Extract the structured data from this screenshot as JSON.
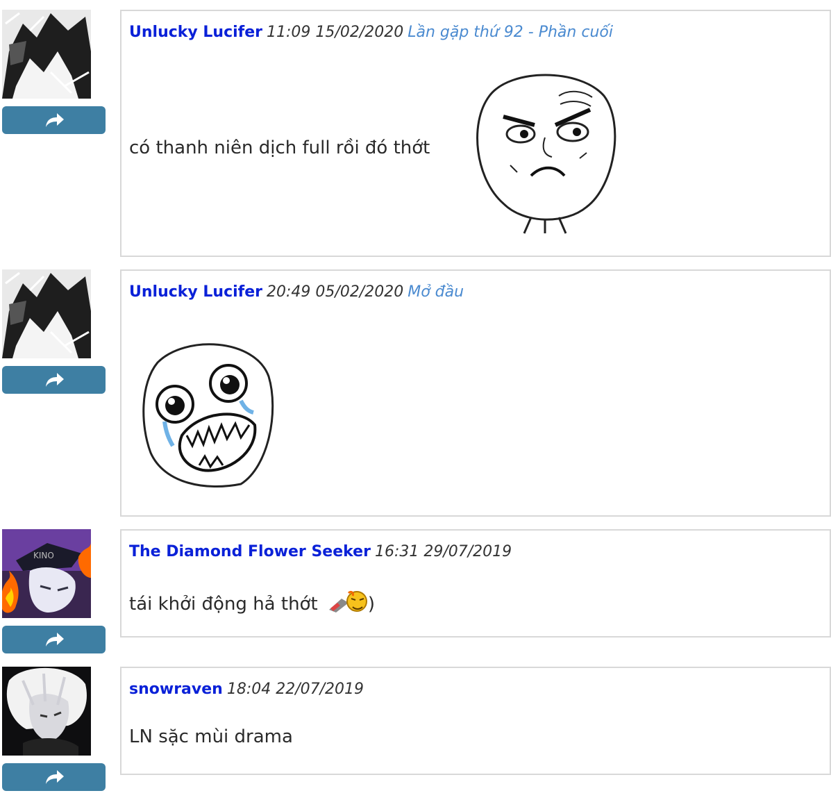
{
  "comments": [
    {
      "author": "Unlucky Lucifer",
      "time": "11:09 15/02/2020",
      "chapter": "Lần gặp thứ 92 - Phần cuối",
      "text": "có thanh niên dịch full rồi đó thớt",
      "avatar": "dark-sketch-avatar",
      "sticker": "determined-meme-face"
    },
    {
      "author": "Unlucky Lucifer",
      "time": "20:49 05/02/2020",
      "chapter": "Mở đầu",
      "text": "",
      "avatar": "dark-sketch-avatar",
      "sticker": "happy-crying-meme-face"
    },
    {
      "author": "The Diamond Flower Seeker",
      "time": "16:31 29/07/2019",
      "chapter": "",
      "text": "tái khởi động hả thớt",
      "text_suffix": ")",
      "avatar": "anime-purple-avatar",
      "sticker": "emoji-sticker"
    },
    {
      "author": "snowraven",
      "time": "18:04 22/07/2019",
      "chapter": "",
      "text": "LN sặc mùi drama",
      "avatar": "white-hair-avatar",
      "sticker": ""
    }
  ],
  "icons": {
    "reply": "share-arrow-icon"
  },
  "colors": {
    "author": "#0a21d8",
    "chapter": "#4a8ad0",
    "reply_button": "#3e7fa3"
  }
}
